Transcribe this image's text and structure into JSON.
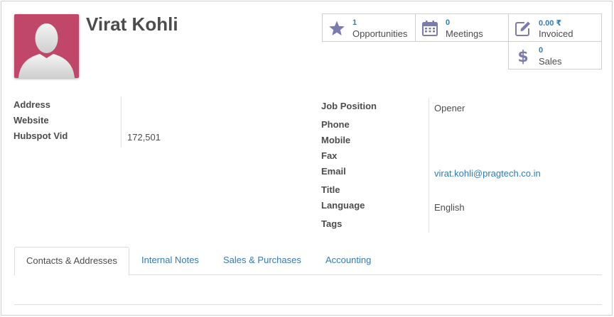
{
  "partner": {
    "name": "Virat Kohli"
  },
  "stats": [
    {
      "value": "1",
      "label": "Opportunities",
      "icon": "star-icon"
    },
    {
      "value": "0",
      "label": "Meetings",
      "icon": "calendar-icon"
    },
    {
      "value": "0.00 ₹",
      "label": "Invoiced",
      "icon": "pencil-square-icon"
    },
    {
      "value": "0",
      "label": "Sales",
      "icon": "dollar-icon"
    }
  ],
  "left_fields": {
    "address_label": "Address",
    "website_label": "Website",
    "hubspot_label": "Hubspot Vid",
    "hubspot_value": "172,501"
  },
  "right_fields": {
    "job_position_label": "Job Position",
    "job_position_value": "Opener",
    "phone_label": "Phone",
    "mobile_label": "Mobile",
    "fax_label": "Fax",
    "email_label": "Email",
    "email_value": "virat.kohli@pragtech.co.in",
    "title_label": "Title",
    "language_label": "Language",
    "language_value": "English",
    "tags_label": "Tags"
  },
  "tabs": [
    {
      "label": "Contacts & Addresses",
      "active": true
    },
    {
      "label": "Internal Notes",
      "active": false
    },
    {
      "label": "Sales & Purchases",
      "active": false
    },
    {
      "label": "Accounting",
      "active": false
    }
  ],
  "colors": {
    "avatar_bg": "#c0466a",
    "link": "#337ab7",
    "icon": "#7c7bad"
  }
}
